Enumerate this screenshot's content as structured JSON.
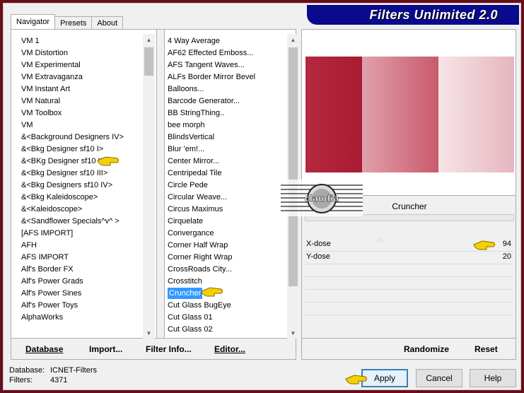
{
  "window": {
    "title": "Filters Unlimited 2.0"
  },
  "tabs": [
    {
      "label": "Navigator"
    },
    {
      "label": "Presets"
    },
    {
      "label": "About"
    }
  ],
  "categories": [
    "VM 1",
    "VM Distortion",
    "VM Experimental",
    "VM Extravaganza",
    "VM Instant Art",
    "VM Natural",
    "VM Toolbox",
    "VM",
    "&<Background Designers IV>",
    "&<Bkg Designer sf10 I>",
    "&<BKg Designer sf10 II>",
    "&<Bkg Designer sf10 III>",
    "&<Bkg Designers sf10 IV>",
    "&<Bkg Kaleidoscope>",
    "&<Kaleidoscope>",
    "&<Sandflower Specials^v^ >",
    "[AFS IMPORT]",
    "AFH",
    "AFS IMPORT",
    "Alf's Border FX",
    "Alf's Power Grads",
    "Alf's Power Sines",
    "Alf's Power Toys",
    "AlphaWorks"
  ],
  "filters": [
    "4 Way Average",
    "AF62 Effected Emboss...",
    "AFS Tangent Waves...",
    "ALFs Border Mirror Bevel",
    "Balloons...",
    "Barcode Generator...",
    "BB StringThing..",
    "bee morph",
    "BlindsVertical",
    "Blur 'em!...",
    "Center Mirror...",
    "Centripedal Tile",
    "Circle Pede",
    "Circular Weave...",
    "Circus Maximus",
    "Cirquelate",
    "Convergance",
    "Corner Half Wrap",
    "Corner Right Wrap",
    "CrossRoads City...",
    "Crosstitch",
    "Cruncher",
    "Cut Glass  BugEye",
    "Cut Glass 01",
    "Cut Glass 02"
  ],
  "selected_filter_index": 21,
  "preview": {
    "filter_name": "Cruncher",
    "watermark_text": "claudia",
    "colors": [
      "#a81b30",
      "#d67b8b",
      "#f2d3d8"
    ]
  },
  "params": [
    {
      "label": "X-dose",
      "value": "94"
    },
    {
      "label": "Y-dose",
      "value": "20"
    }
  ],
  "left_buttons": {
    "database": "Database",
    "import": "Import...",
    "filter_info": "Filter Info...",
    "editor": "Editor..."
  },
  "right_buttons": {
    "randomize": "Randomize",
    "reset": "Reset"
  },
  "status": {
    "database_label": "Database:",
    "database_value": "ICNET-Filters",
    "filters_label": "Filters:",
    "filters_value": "4371"
  },
  "dialog_buttons": {
    "apply": "Apply",
    "cancel": "Cancel",
    "help": "Help"
  },
  "colors": {
    "banner": "#0a0a8c",
    "frame": "#6a0d1a",
    "selection": "#3399ff",
    "pointer": "#f5d000"
  }
}
